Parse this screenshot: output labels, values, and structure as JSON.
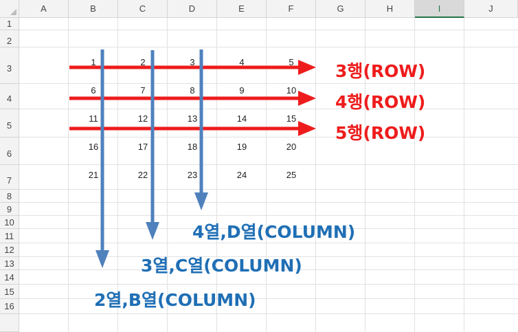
{
  "columns": [
    "A",
    "B",
    "C",
    "D",
    "E",
    "F",
    "G",
    "H",
    "I",
    "J"
  ],
  "selected_column": "I",
  "rows": [
    "1",
    "2",
    "3",
    "4",
    "5",
    "6",
    "7",
    "8",
    "9",
    "10",
    "11",
    "12",
    "13",
    "14",
    "15",
    "16"
  ],
  "grid_values": [
    [
      "1",
      "2",
      "3",
      "4",
      "5"
    ],
    [
      "6",
      "7",
      "8",
      "9",
      "10"
    ],
    [
      "11",
      "12",
      "13",
      "14",
      "15"
    ],
    [
      "16",
      "17",
      "18",
      "19",
      "20"
    ],
    [
      "21",
      "22",
      "23",
      "24",
      "25"
    ]
  ],
  "row_labels": [
    "3행(ROW)",
    "4행(ROW)",
    "5행(ROW)"
  ],
  "column_labels": [
    "4열,D열(COLUMN)",
    "3열,C열(COLUMN)",
    "2열,B열(COLUMN)"
  ],
  "colors": {
    "row_arrow": "#ee1c1c",
    "column_arrow": "#4f81bd",
    "header_bg": "#f3f3f3",
    "selected_accent": "#217346"
  }
}
